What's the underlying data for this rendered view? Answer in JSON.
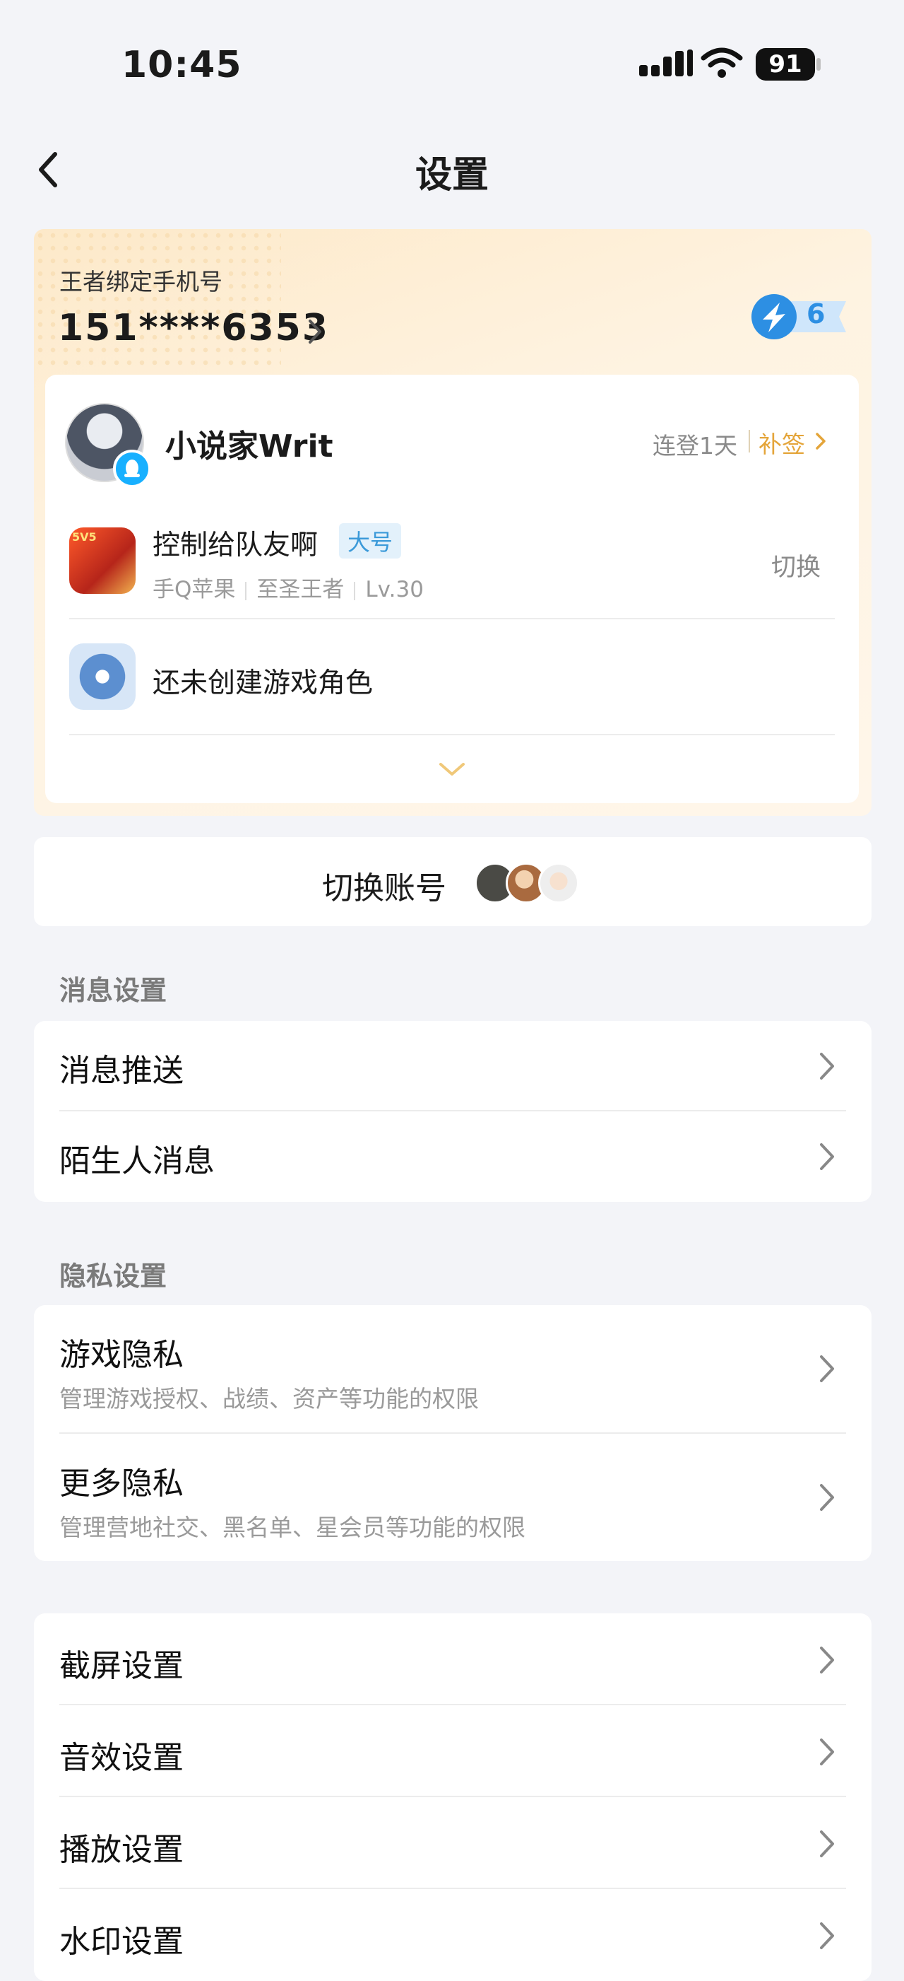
{
  "status_bar": {
    "time": "10:45",
    "battery": "91"
  },
  "nav": {
    "title": "设置"
  },
  "account_card": {
    "bind_label": "王者绑定手机号",
    "phone": "151****6353",
    "level": "6",
    "username": "小说家Writ",
    "login_streak": "连登1天",
    "makeup_sign": "补签",
    "roles": [
      {
        "name": "控制给队友啊",
        "tag": "大号",
        "platform": "手Q苹果",
        "rank": "至圣王者",
        "level": "Lv.30",
        "action": "切换",
        "icon_text": "5V5"
      },
      {
        "name": "还未创建游戏角色"
      }
    ]
  },
  "switch_account": {
    "label": "切换账号"
  },
  "sections": {
    "message": {
      "title": "消息设置",
      "items": [
        {
          "label": "消息推送"
        },
        {
          "label": "陌生人消息"
        }
      ]
    },
    "privacy": {
      "title": "隐私设置",
      "items": [
        {
          "label": "游戏隐私",
          "sub": "管理游戏授权、战绩、资产等功能的权限"
        },
        {
          "label": "更多隐私",
          "sub": "管理营地社交、黑名单、星会员等功能的权限"
        }
      ]
    },
    "other": {
      "items": [
        {
          "label": "截屏设置"
        },
        {
          "label": "音效设置"
        },
        {
          "label": "播放设置"
        },
        {
          "label": "水印设置"
        }
      ]
    }
  },
  "colors": {
    "accent": "#e4a53a",
    "link_blue": "#3b9ad9",
    "background": "#f3f4f8"
  }
}
